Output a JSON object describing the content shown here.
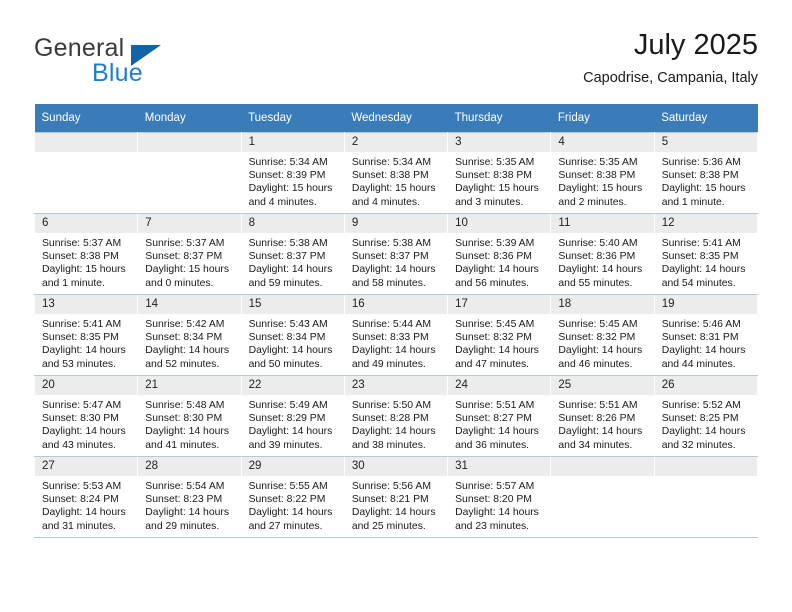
{
  "logo": {
    "word1": "General",
    "word2": "Blue",
    "triangle_color": "#1463a6",
    "blue_color": "#1d7fd0"
  },
  "header": {
    "title": "July 2025",
    "subtitle": "Capodrise, Campania, Italy"
  },
  "theme": {
    "header_row_bg": "#3a7cb9",
    "daynum_bg": "#ececec",
    "grid_line": "#b9c8d6"
  },
  "calendar": {
    "weekday_headers": [
      "Sunday",
      "Monday",
      "Tuesday",
      "Wednesday",
      "Thursday",
      "Friday",
      "Saturday"
    ],
    "weeks": [
      [
        {
          "day": "",
          "empty": true
        },
        {
          "day": "",
          "empty": true
        },
        {
          "day": "1",
          "sunrise": "Sunrise: 5:34 AM",
          "sunset": "Sunset: 8:39 PM",
          "daylight": "Daylight: 15 hours and 4 minutes."
        },
        {
          "day": "2",
          "sunrise": "Sunrise: 5:34 AM",
          "sunset": "Sunset: 8:38 PM",
          "daylight": "Daylight: 15 hours and 4 minutes."
        },
        {
          "day": "3",
          "sunrise": "Sunrise: 5:35 AM",
          "sunset": "Sunset: 8:38 PM",
          "daylight": "Daylight: 15 hours and 3 minutes."
        },
        {
          "day": "4",
          "sunrise": "Sunrise: 5:35 AM",
          "sunset": "Sunset: 8:38 PM",
          "daylight": "Daylight: 15 hours and 2 minutes."
        },
        {
          "day": "5",
          "sunrise": "Sunrise: 5:36 AM",
          "sunset": "Sunset: 8:38 PM",
          "daylight": "Daylight: 15 hours and 1 minute."
        }
      ],
      [
        {
          "day": "6",
          "sunrise": "Sunrise: 5:37 AM",
          "sunset": "Sunset: 8:38 PM",
          "daylight": "Daylight: 15 hours and 1 minute."
        },
        {
          "day": "7",
          "sunrise": "Sunrise: 5:37 AM",
          "sunset": "Sunset: 8:37 PM",
          "daylight": "Daylight: 15 hours and 0 minutes."
        },
        {
          "day": "8",
          "sunrise": "Sunrise: 5:38 AM",
          "sunset": "Sunset: 8:37 PM",
          "daylight": "Daylight: 14 hours and 59 minutes."
        },
        {
          "day": "9",
          "sunrise": "Sunrise: 5:38 AM",
          "sunset": "Sunset: 8:37 PM",
          "daylight": "Daylight: 14 hours and 58 minutes."
        },
        {
          "day": "10",
          "sunrise": "Sunrise: 5:39 AM",
          "sunset": "Sunset: 8:36 PM",
          "daylight": "Daylight: 14 hours and 56 minutes."
        },
        {
          "day": "11",
          "sunrise": "Sunrise: 5:40 AM",
          "sunset": "Sunset: 8:36 PM",
          "daylight": "Daylight: 14 hours and 55 minutes."
        },
        {
          "day": "12",
          "sunrise": "Sunrise: 5:41 AM",
          "sunset": "Sunset: 8:35 PM",
          "daylight": "Daylight: 14 hours and 54 minutes."
        }
      ],
      [
        {
          "day": "13",
          "sunrise": "Sunrise: 5:41 AM",
          "sunset": "Sunset: 8:35 PM",
          "daylight": "Daylight: 14 hours and 53 minutes."
        },
        {
          "day": "14",
          "sunrise": "Sunrise: 5:42 AM",
          "sunset": "Sunset: 8:34 PM",
          "daylight": "Daylight: 14 hours and 52 minutes."
        },
        {
          "day": "15",
          "sunrise": "Sunrise: 5:43 AM",
          "sunset": "Sunset: 8:34 PM",
          "daylight": "Daylight: 14 hours and 50 minutes."
        },
        {
          "day": "16",
          "sunrise": "Sunrise: 5:44 AM",
          "sunset": "Sunset: 8:33 PM",
          "daylight": "Daylight: 14 hours and 49 minutes."
        },
        {
          "day": "17",
          "sunrise": "Sunrise: 5:45 AM",
          "sunset": "Sunset: 8:32 PM",
          "daylight": "Daylight: 14 hours and 47 minutes."
        },
        {
          "day": "18",
          "sunrise": "Sunrise: 5:45 AM",
          "sunset": "Sunset: 8:32 PM",
          "daylight": "Daylight: 14 hours and 46 minutes."
        },
        {
          "day": "19",
          "sunrise": "Sunrise: 5:46 AM",
          "sunset": "Sunset: 8:31 PM",
          "daylight": "Daylight: 14 hours and 44 minutes."
        }
      ],
      [
        {
          "day": "20",
          "sunrise": "Sunrise: 5:47 AM",
          "sunset": "Sunset: 8:30 PM",
          "daylight": "Daylight: 14 hours and 43 minutes."
        },
        {
          "day": "21",
          "sunrise": "Sunrise: 5:48 AM",
          "sunset": "Sunset: 8:30 PM",
          "daylight": "Daylight: 14 hours and 41 minutes."
        },
        {
          "day": "22",
          "sunrise": "Sunrise: 5:49 AM",
          "sunset": "Sunset: 8:29 PM",
          "daylight": "Daylight: 14 hours and 39 minutes."
        },
        {
          "day": "23",
          "sunrise": "Sunrise: 5:50 AM",
          "sunset": "Sunset: 8:28 PM",
          "daylight": "Daylight: 14 hours and 38 minutes."
        },
        {
          "day": "24",
          "sunrise": "Sunrise: 5:51 AM",
          "sunset": "Sunset: 8:27 PM",
          "daylight": "Daylight: 14 hours and 36 minutes."
        },
        {
          "day": "25",
          "sunrise": "Sunrise: 5:51 AM",
          "sunset": "Sunset: 8:26 PM",
          "daylight": "Daylight: 14 hours and 34 minutes."
        },
        {
          "day": "26",
          "sunrise": "Sunrise: 5:52 AM",
          "sunset": "Sunset: 8:25 PM",
          "daylight": "Daylight: 14 hours and 32 minutes."
        }
      ],
      [
        {
          "day": "27",
          "sunrise": "Sunrise: 5:53 AM",
          "sunset": "Sunset: 8:24 PM",
          "daylight": "Daylight: 14 hours and 31 minutes."
        },
        {
          "day": "28",
          "sunrise": "Sunrise: 5:54 AM",
          "sunset": "Sunset: 8:23 PM",
          "daylight": "Daylight: 14 hours and 29 minutes."
        },
        {
          "day": "29",
          "sunrise": "Sunrise: 5:55 AM",
          "sunset": "Sunset: 8:22 PM",
          "daylight": "Daylight: 14 hours and 27 minutes."
        },
        {
          "day": "30",
          "sunrise": "Sunrise: 5:56 AM",
          "sunset": "Sunset: 8:21 PM",
          "daylight": "Daylight: 14 hours and 25 minutes."
        },
        {
          "day": "31",
          "sunrise": "Sunrise: 5:57 AM",
          "sunset": "Sunset: 8:20 PM",
          "daylight": "Daylight: 14 hours and 23 minutes."
        },
        {
          "day": "",
          "empty": true
        },
        {
          "day": "",
          "empty": true
        }
      ]
    ]
  }
}
